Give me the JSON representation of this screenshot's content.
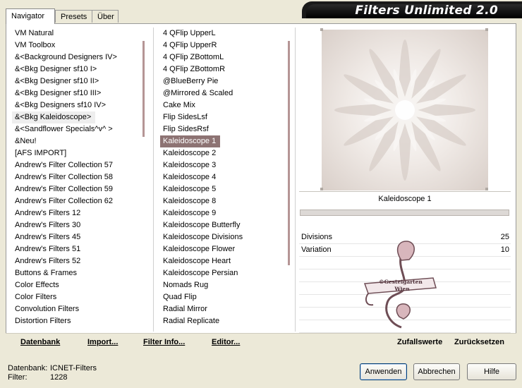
{
  "app": {
    "title": "Filters Unlimited 2.0"
  },
  "tabs": [
    "Navigator",
    "Presets",
    "Über"
  ],
  "categories": [
    "VM Natural",
    "VM Toolbox",
    "&<Background Designers IV>",
    "&<Bkg Designer sf10 I>",
    "&<Bkg Designer sf10 II>",
    "&<Bkg Designer sf10 III>",
    "&<Bkg Designers sf10 IV>",
    "&<Bkg Kaleidoscope>",
    "&<Sandflower Specials^v^ >",
    "&Neu!",
    "[AFS IMPORT]",
    "Andrew's Filter Collection 57",
    "Andrew's Filter Collection 58",
    "Andrew's Filter Collection 59",
    "Andrew's Filter Collection 62",
    "Andrew's Filters 12",
    "Andrew's Filters 30",
    "Andrew's Filters 45",
    "Andrew's Filters 51",
    "Andrew's Filters 52",
    "Buttons & Frames",
    "Color Effects",
    "Color Filters",
    "Convolution Filters",
    "Distortion Filters"
  ],
  "selected_category": "&<Bkg Kaleidoscope>",
  "filters": [
    "4 QFlip UpperL",
    "4 QFlip UpperR",
    "4 QFlip ZBottomL",
    "4 QFlip ZBottomR",
    "@BlueBerry Pie",
    "@Mirrored & Scaled",
    "Cake Mix",
    "Flip SidesLsf",
    "Flip SidesRsf",
    "Kaleidoscope 1",
    "Kaleidoscope 2",
    "Kaleidoscope 3",
    "Kaleidoscope 4",
    "Kaleidoscope 5",
    "Kaleidoscope 8",
    "Kaleidoscope 9",
    "Kaleidoscope Butterfly",
    "Kaleidoscope Divisions",
    "Kaleidoscope Flower",
    "Kaleidoscope Heart",
    "Kaleidoscope Persian",
    "Nomads Rug",
    "Quad Flip",
    "Radial Mirror",
    "Radial Replicate"
  ],
  "selected_filter": "Kaleidoscope 1",
  "preview": {
    "caption": "Kaleidoscope 1"
  },
  "params": [
    {
      "label": "Divisions",
      "value": "25"
    },
    {
      "label": "Variation",
      "value": "10"
    }
  ],
  "watermark": {
    "line1": "©Gesteigarten",
    "line2": "Wien"
  },
  "toolbar": {
    "datenbank": "Datenbank",
    "import": "Import...",
    "filter_info": "Filter Info...",
    "editor": "Editor...",
    "zufallswerte": "Zufallswerte",
    "zuruecksetzen": "Zurücksetzen"
  },
  "status": {
    "db_label": "Datenbank:",
    "db_value": "ICNET-Filters",
    "filter_label": "Filter:",
    "filter_value": "1228"
  },
  "buttons": {
    "apply": "Anwenden",
    "cancel": "Abbrechen",
    "help": "Hilfe"
  },
  "colors": {
    "selection": "#8d7373",
    "window_bg": "#ece9d8"
  }
}
